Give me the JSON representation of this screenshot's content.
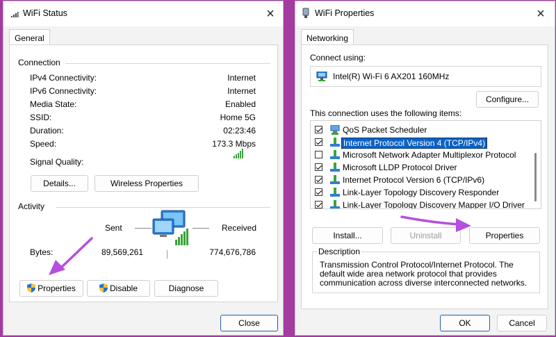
{
  "status_window": {
    "title": "WiFi Status",
    "tab": "General",
    "connection_title": "Connection",
    "rows": [
      {
        "label": "IPv4 Connectivity:",
        "value": "Internet"
      },
      {
        "label": "IPv6 Connectivity:",
        "value": "Internet"
      },
      {
        "label": "Media State:",
        "value": "Enabled"
      },
      {
        "label": "SSID:",
        "value": "Home 5G"
      },
      {
        "label": "Duration:",
        "value": "02:23:46"
      },
      {
        "label": "Speed:",
        "value": "173.3 Mbps"
      }
    ],
    "signal_label": "Signal Quality:",
    "details_button": "Details...",
    "wireless_button": "Wireless Properties",
    "activity_title": "Activity",
    "sent_label": "Sent",
    "received_label": "Received",
    "bytes_label": "Bytes:",
    "bytes_sent": "89,569,261",
    "bytes_received": "774,676,786",
    "properties_button": "Properties",
    "disable_button": "Disable",
    "diagnose_button": "Diagnose",
    "close_button": "Close"
  },
  "properties_window": {
    "title": "WiFi Properties",
    "tab": "Networking",
    "connect_using_label": "Connect using:",
    "adapter_name": "Intel(R) Wi-Fi 6 AX201 160MHz",
    "configure_button": "Configure...",
    "items_label": "This connection uses the following items:",
    "items": [
      {
        "label": "QoS Packet Scheduler",
        "checked": true,
        "selected": false
      },
      {
        "label": "Internet Protocol Version 4 (TCP/IPv4)",
        "checked": true,
        "selected": true
      },
      {
        "label": "Microsoft Network Adapter Multiplexor Protocol",
        "checked": false,
        "selected": false
      },
      {
        "label": "Microsoft LLDP Protocol Driver",
        "checked": true,
        "selected": false
      },
      {
        "label": "Internet Protocol Version 6 (TCP/IPv6)",
        "checked": true,
        "selected": false
      },
      {
        "label": "Link-Layer Topology Discovery Responder",
        "checked": true,
        "selected": false
      },
      {
        "label": "Link-Layer Topology Discovery Mapper I/O Driver",
        "checked": true,
        "selected": false
      }
    ],
    "install_button": "Install...",
    "uninstall_button": "Uninstall",
    "properties_button": "Properties",
    "description_title": "Description",
    "description_text": "Transmission Control Protocol/Internet Protocol. The default wide area network protocol that provides communication across diverse interconnected networks.",
    "ok_button": "OK",
    "cancel_button": "Cancel"
  },
  "colors": {
    "background": "#a33ba1",
    "arrow": "#b44fe0",
    "selection": "#0b63c7",
    "signal": "#3aa53a"
  }
}
